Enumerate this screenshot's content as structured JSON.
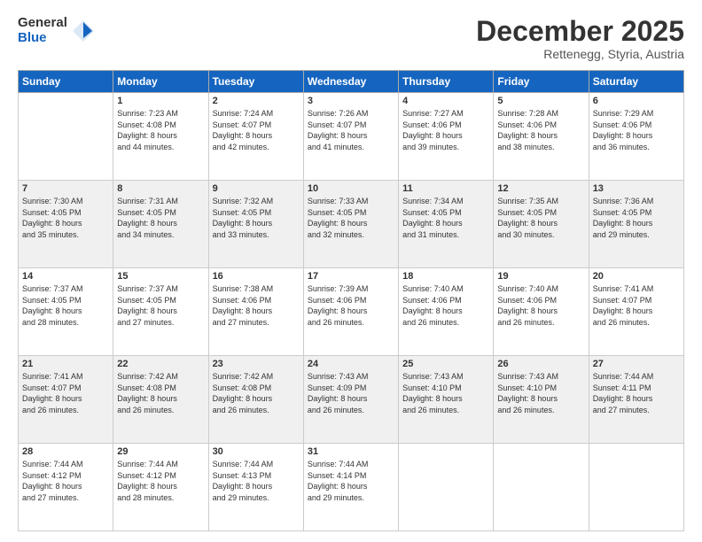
{
  "logo": {
    "general": "General",
    "blue": "Blue"
  },
  "header": {
    "month": "December 2025",
    "location": "Rettenegg, Styria, Austria"
  },
  "weekdays": [
    "Sunday",
    "Monday",
    "Tuesday",
    "Wednesday",
    "Thursday",
    "Friday",
    "Saturday"
  ],
  "weeks": [
    [
      {
        "day": "",
        "info": ""
      },
      {
        "day": "1",
        "info": "Sunrise: 7:23 AM\nSunset: 4:08 PM\nDaylight: 8 hours\nand 44 minutes."
      },
      {
        "day": "2",
        "info": "Sunrise: 7:24 AM\nSunset: 4:07 PM\nDaylight: 8 hours\nand 42 minutes."
      },
      {
        "day": "3",
        "info": "Sunrise: 7:26 AM\nSunset: 4:07 PM\nDaylight: 8 hours\nand 41 minutes."
      },
      {
        "day": "4",
        "info": "Sunrise: 7:27 AM\nSunset: 4:06 PM\nDaylight: 8 hours\nand 39 minutes."
      },
      {
        "day": "5",
        "info": "Sunrise: 7:28 AM\nSunset: 4:06 PM\nDaylight: 8 hours\nand 38 minutes."
      },
      {
        "day": "6",
        "info": "Sunrise: 7:29 AM\nSunset: 4:06 PM\nDaylight: 8 hours\nand 36 minutes."
      }
    ],
    [
      {
        "day": "7",
        "info": "Sunrise: 7:30 AM\nSunset: 4:05 PM\nDaylight: 8 hours\nand 35 minutes."
      },
      {
        "day": "8",
        "info": "Sunrise: 7:31 AM\nSunset: 4:05 PM\nDaylight: 8 hours\nand 34 minutes."
      },
      {
        "day": "9",
        "info": "Sunrise: 7:32 AM\nSunset: 4:05 PM\nDaylight: 8 hours\nand 33 minutes."
      },
      {
        "day": "10",
        "info": "Sunrise: 7:33 AM\nSunset: 4:05 PM\nDaylight: 8 hours\nand 32 minutes."
      },
      {
        "day": "11",
        "info": "Sunrise: 7:34 AM\nSunset: 4:05 PM\nDaylight: 8 hours\nand 31 minutes."
      },
      {
        "day": "12",
        "info": "Sunrise: 7:35 AM\nSunset: 4:05 PM\nDaylight: 8 hours\nand 30 minutes."
      },
      {
        "day": "13",
        "info": "Sunrise: 7:36 AM\nSunset: 4:05 PM\nDaylight: 8 hours\nand 29 minutes."
      }
    ],
    [
      {
        "day": "14",
        "info": "Sunrise: 7:37 AM\nSunset: 4:05 PM\nDaylight: 8 hours\nand 28 minutes."
      },
      {
        "day": "15",
        "info": "Sunrise: 7:37 AM\nSunset: 4:05 PM\nDaylight: 8 hours\nand 27 minutes."
      },
      {
        "day": "16",
        "info": "Sunrise: 7:38 AM\nSunset: 4:06 PM\nDaylight: 8 hours\nand 27 minutes."
      },
      {
        "day": "17",
        "info": "Sunrise: 7:39 AM\nSunset: 4:06 PM\nDaylight: 8 hours\nand 26 minutes."
      },
      {
        "day": "18",
        "info": "Sunrise: 7:40 AM\nSunset: 4:06 PM\nDaylight: 8 hours\nand 26 minutes."
      },
      {
        "day": "19",
        "info": "Sunrise: 7:40 AM\nSunset: 4:06 PM\nDaylight: 8 hours\nand 26 minutes."
      },
      {
        "day": "20",
        "info": "Sunrise: 7:41 AM\nSunset: 4:07 PM\nDaylight: 8 hours\nand 26 minutes."
      }
    ],
    [
      {
        "day": "21",
        "info": "Sunrise: 7:41 AM\nSunset: 4:07 PM\nDaylight: 8 hours\nand 26 minutes."
      },
      {
        "day": "22",
        "info": "Sunrise: 7:42 AM\nSunset: 4:08 PM\nDaylight: 8 hours\nand 26 minutes."
      },
      {
        "day": "23",
        "info": "Sunrise: 7:42 AM\nSunset: 4:08 PM\nDaylight: 8 hours\nand 26 minutes."
      },
      {
        "day": "24",
        "info": "Sunrise: 7:43 AM\nSunset: 4:09 PM\nDaylight: 8 hours\nand 26 minutes."
      },
      {
        "day": "25",
        "info": "Sunrise: 7:43 AM\nSunset: 4:10 PM\nDaylight: 8 hours\nand 26 minutes."
      },
      {
        "day": "26",
        "info": "Sunrise: 7:43 AM\nSunset: 4:10 PM\nDaylight: 8 hours\nand 26 minutes."
      },
      {
        "day": "27",
        "info": "Sunrise: 7:44 AM\nSunset: 4:11 PM\nDaylight: 8 hours\nand 27 minutes."
      }
    ],
    [
      {
        "day": "28",
        "info": "Sunrise: 7:44 AM\nSunset: 4:12 PM\nDaylight: 8 hours\nand 27 minutes."
      },
      {
        "day": "29",
        "info": "Sunrise: 7:44 AM\nSunset: 4:12 PM\nDaylight: 8 hours\nand 28 minutes."
      },
      {
        "day": "30",
        "info": "Sunrise: 7:44 AM\nSunset: 4:13 PM\nDaylight: 8 hours\nand 29 minutes."
      },
      {
        "day": "31",
        "info": "Sunrise: 7:44 AM\nSunset: 4:14 PM\nDaylight: 8 hours\nand 29 minutes."
      },
      {
        "day": "",
        "info": ""
      },
      {
        "day": "",
        "info": ""
      },
      {
        "day": "",
        "info": ""
      }
    ]
  ]
}
